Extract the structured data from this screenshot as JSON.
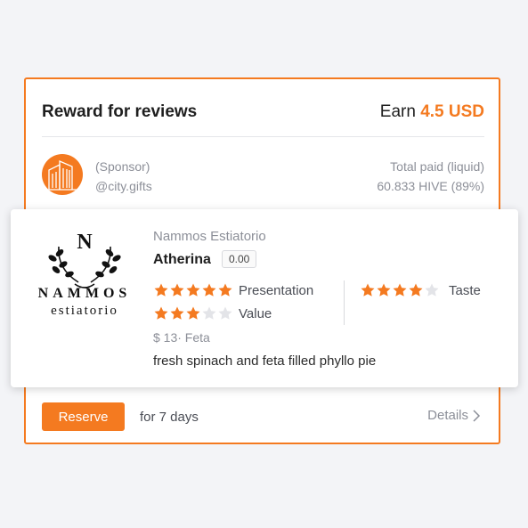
{
  "reward": {
    "title": "Reward for reviews",
    "earn_label": "Earn",
    "earn_amount": "4.5 USD",
    "sponsor_label": "(Sponsor)",
    "sponsor_handle": "@city.gifts",
    "paid_label": "Total paid (liquid)",
    "paid_value": "60.833 HIVE (89%)"
  },
  "dish": {
    "logo_letter": "N",
    "logo_line1": "NAMMOS",
    "logo_line2": "estiatorio",
    "restaurant": "Nammos Estiatorio",
    "name": "Atherina",
    "score": "0.00",
    "ratings": [
      {
        "label": "Presentation",
        "value": 5,
        "max": 5
      },
      {
        "label": "Taste",
        "value": 4,
        "max": 5
      },
      {
        "label": "Value",
        "value": 3,
        "max": 5
      }
    ],
    "price": "$ 13",
    "category": "Feta",
    "price_line": "$ 13· Feta",
    "description": "fresh spinach and feta filled phyllo pie"
  },
  "footer": {
    "reserve_label": "Reserve",
    "duration": "for 7 days",
    "details_label": "Details"
  },
  "colors": {
    "accent": "#f47a20",
    "star_filled": "#f47a20",
    "star_empty": "#e3e4e8"
  }
}
